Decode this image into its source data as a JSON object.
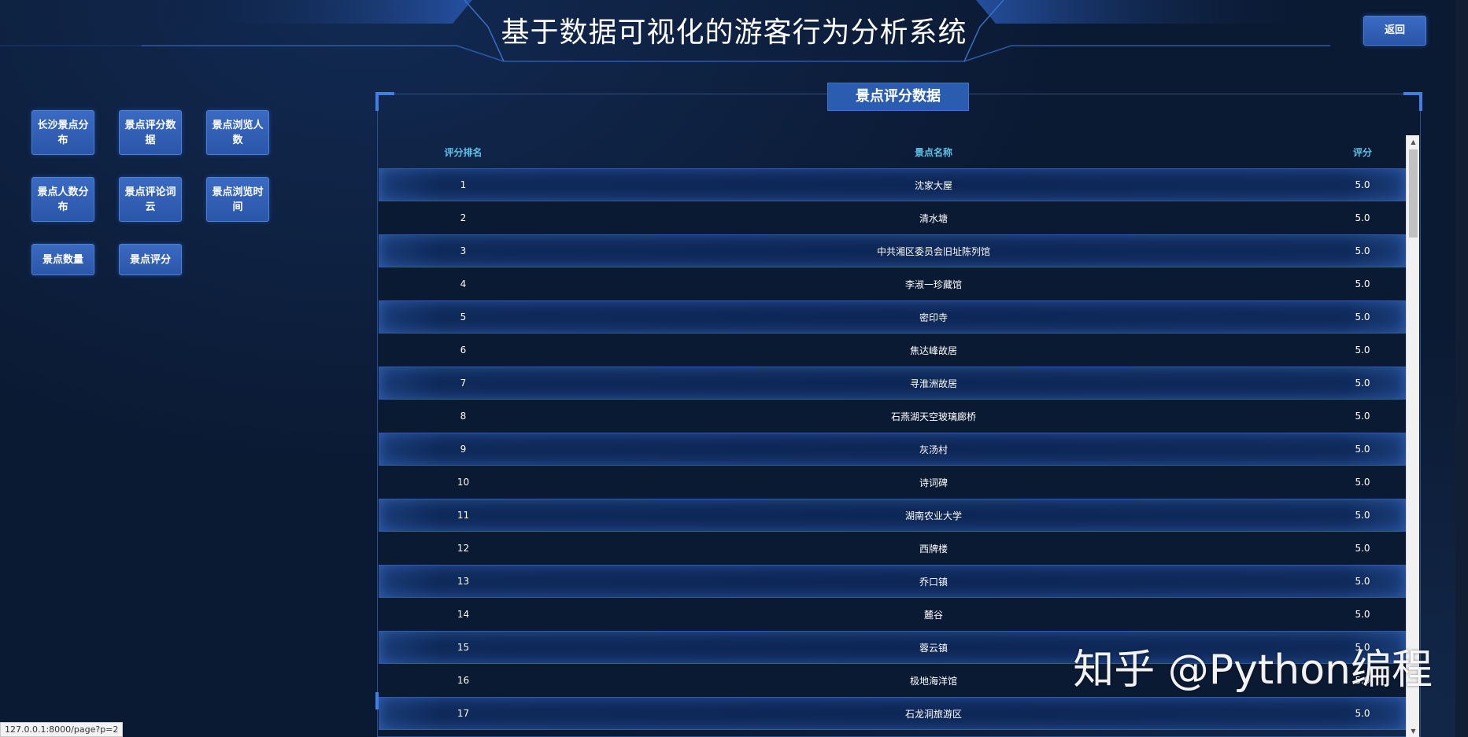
{
  "header": {
    "title": "基于数据可视化的游客行为分析系统",
    "back_label": "返回"
  },
  "nav": {
    "items": [
      {
        "label": "长沙景点分布"
      },
      {
        "label": "景点评分数据"
      },
      {
        "label": "景点浏览人数"
      },
      {
        "label": "景点人数分布"
      },
      {
        "label": "景点评论词云"
      },
      {
        "label": "景点浏览时间"
      },
      {
        "label": "景点数量"
      },
      {
        "label": "景点评分"
      }
    ]
  },
  "panel": {
    "title": "景点评分数据",
    "columns": {
      "rank": "评分排名",
      "name": "景点名称",
      "score": "评分"
    },
    "rows": [
      {
        "rank": "1",
        "name": "沈家大屋",
        "score": "5.0"
      },
      {
        "rank": "2",
        "name": "清水塘",
        "score": "5.0"
      },
      {
        "rank": "3",
        "name": "中共湘区委员会旧址陈列馆",
        "score": "5.0"
      },
      {
        "rank": "4",
        "name": "李淑一珍藏馆",
        "score": "5.0"
      },
      {
        "rank": "5",
        "name": "密印寺",
        "score": "5.0"
      },
      {
        "rank": "6",
        "name": "焦达峰故居",
        "score": "5.0"
      },
      {
        "rank": "7",
        "name": "寻淮洲故居",
        "score": "5.0"
      },
      {
        "rank": "8",
        "name": "石燕湖天空玻璃廊桥",
        "score": "5.0"
      },
      {
        "rank": "9",
        "name": "灰汤村",
        "score": "5.0"
      },
      {
        "rank": "10",
        "name": "诗词碑",
        "score": "5.0"
      },
      {
        "rank": "11",
        "name": "湖南农业大学",
        "score": "5.0"
      },
      {
        "rank": "12",
        "name": "西牌楼",
        "score": "5.0"
      },
      {
        "rank": "13",
        "name": "乔口镇",
        "score": "5.0"
      },
      {
        "rank": "14",
        "name": "麓谷",
        "score": "5.0"
      },
      {
        "rank": "15",
        "name": "蓉云镇",
        "score": "5.0"
      },
      {
        "rank": "16",
        "name": "极地海洋馆",
        "score": "5.0"
      },
      {
        "rank": "17",
        "name": "石龙洞旅游区",
        "score": "5.0"
      }
    ]
  },
  "watermark": "知乎 @Python编程",
  "status_url": "127.0.0.1:8000/page?p=2",
  "colors": {
    "background": "#0b1a33",
    "button": "#2b56a9",
    "header_text_accent": "#5fc2e8",
    "panel_border": "#2a4f8f"
  },
  "icons": {
    "scroll_up": "triangle-up-icon",
    "scroll_down": "triangle-down-icon"
  }
}
